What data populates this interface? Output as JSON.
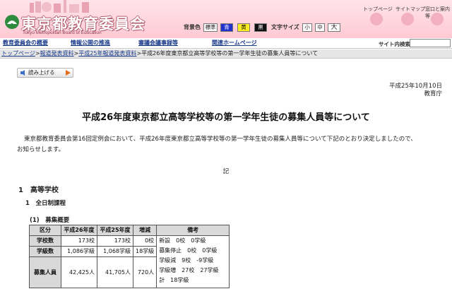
{
  "header": {
    "logo_title": "東京都教育委員会",
    "logo_subtitle": "Tokyo Metropolitan Board of Education",
    "bgcolor_label": "背景色",
    "bg_options": [
      "標準",
      "青",
      "黄",
      "黒"
    ],
    "fontsize_label": "文字サイズ",
    "font_options": [
      "小",
      "中",
      "大"
    ],
    "top_links": [
      "トップページ",
      "サイトマップ",
      "窓口と案内等"
    ]
  },
  "nav": {
    "items": [
      "教育委員会の概要",
      "情報公開の推進",
      "審議会議事録等",
      "関連ホームページ"
    ],
    "search_label": "サイト内検索",
    "search_value": ""
  },
  "breadcrumb": {
    "items": [
      "トップページ",
      "報道発表資料",
      "平成25年報道発表資料"
    ],
    "separator": ">",
    "current": "平成26年度東京都立高等学校等の第一学年生徒の募集人員等について"
  },
  "read_button": {
    "label": "読み上げる"
  },
  "date": {
    "date": "平成25年10月10日",
    "org": "教育庁"
  },
  "title": "平成26年度東京都立高等学校等の第一学年生徒の募集人員等について",
  "body": {
    "line1": "東京都教育委員会第16回定例会において、平成26年度東京都立高等学校等の第一学年生徒の募集人員等について下記のとおり決定しましたので、",
    "line2": "お知らせします。",
    "ki": "記"
  },
  "section1": {
    "num": "1",
    "title": "高等学校"
  },
  "section1_1": {
    "num": "1",
    "title": "全日制課程"
  },
  "section1_1_1": {
    "num": "(1)",
    "title": "募集概要"
  },
  "table": {
    "headers": [
      "区分",
      "平成26年度",
      "平成25年度",
      "増減",
      "備考"
    ],
    "rows": [
      {
        "label": "学校数",
        "a": "173校",
        "b": "173校",
        "c": "0校"
      },
      {
        "label": "学級数",
        "a": "1,086学級",
        "b": "1,068学級",
        "c": "18学級"
      },
      {
        "label": "募集人員",
        "a": "42,425人",
        "b": "41,705人",
        "c": "720人"
      }
    ],
    "notes": [
      "新設　0校　0学級",
      "募集停止　0校　0学級",
      "学級減　9校　-9学級",
      "学級増　27校　27学級",
      "計　18学級"
    ]
  },
  "colors": {
    "header_bg": "#ffd6de",
    "nav_link": "#1a3a8a",
    "table_header_bg": "#d9d9d9",
    "crumb_bg": "#e6e6e6"
  }
}
